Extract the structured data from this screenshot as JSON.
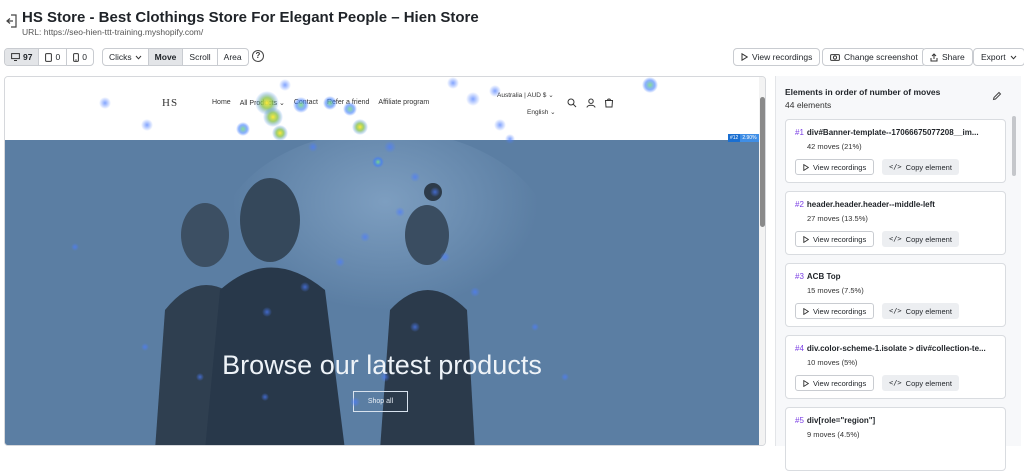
{
  "header": {
    "title": "HS Store - Best Clothings Store For Elegant People – Hien Store",
    "url": "URL: https://seo-hien-ttt-training.myshopify.com/"
  },
  "toolbar": {
    "devices": [
      {
        "icon": "desktop-icon",
        "count": "97"
      },
      {
        "icon": "tablet-icon",
        "count": "0"
      },
      {
        "icon": "mobile-icon",
        "count": "0"
      }
    ],
    "modes": [
      {
        "label": "Clicks",
        "active": false,
        "dropdown": true
      },
      {
        "label": "Move",
        "active": true,
        "dropdown": false
      },
      {
        "label": "Scroll",
        "active": false,
        "dropdown": false
      },
      {
        "label": "Area",
        "active": false,
        "dropdown": false
      }
    ],
    "help_label": "?",
    "view_recordings": "View recordings",
    "change_screenshot": "Change screenshot",
    "share": "Share",
    "export": "Export"
  },
  "site": {
    "logo": "HS",
    "nav": [
      "Home",
      "All Products",
      "Contact",
      "Refer a friend",
      "Affiliate program"
    ],
    "locale": "Australia | AUD $",
    "language": "English",
    "hero_title": "Browse our latest products",
    "hero_button": "Shop all",
    "element_tag": {
      "id": "#12",
      "pct": "2.90%"
    }
  },
  "panel": {
    "title": "Elements in order of number of moves",
    "count": "44 elements",
    "view_recordings_label": "View recordings",
    "copy_label": "Copy element",
    "items": [
      {
        "rank": "#1",
        "name": "div#Banner-template--17066675077208__im...",
        "moves": "42 moves (21%)"
      },
      {
        "rank": "#2",
        "name": "header.header.header--middle-left",
        "moves": "27 moves (13.5%)"
      },
      {
        "rank": "#3",
        "name": "ACB Top",
        "moves": "15 moves (7.5%)"
      },
      {
        "rank": "#4",
        "name": "div.color-scheme-1.isolate > div#collection-te...",
        "moves": "10 moves (5%)"
      },
      {
        "rank": "#5",
        "name": "div[role=\"region\"]",
        "moves": "9 moves (4.5%)"
      }
    ]
  },
  "colors": {
    "accent": "#7b3fe4",
    "hero_bg": "#5b7ea3",
    "tag_blue": "#1a6fd1"
  }
}
